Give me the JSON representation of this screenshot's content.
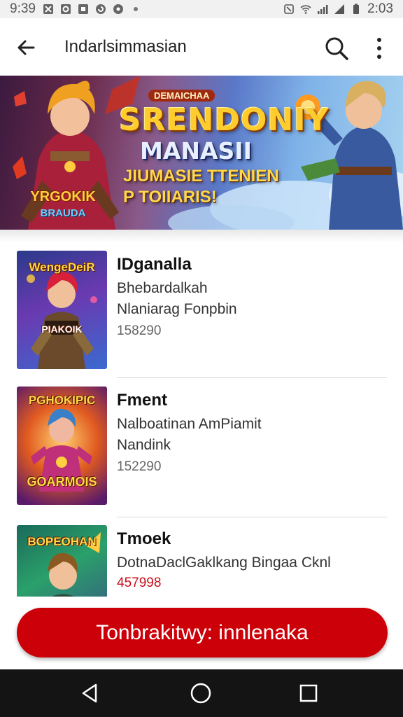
{
  "status_bar": {
    "time_left": "9:39",
    "time_right": "2:03"
  },
  "app_bar": {
    "title": "Indarlsimmasian",
    "back_icon": "arrow-back-icon",
    "search_icon": "search-icon",
    "more_icon": "more-vert-icon"
  },
  "banner": {
    "badge": "DEMAICHAA",
    "title_line1": "SRENDONIY",
    "title_line2": "MANASII",
    "subtitle_line1": "JIUMASIE TTENIEN",
    "subtitle_line2": "P TOIIARIS!",
    "logo_line1": "YRGOKIK",
    "logo_line2": "BRAUDA"
  },
  "list": {
    "items": [
      {
        "title": "IDganalla",
        "line1": "Bhebardalkah",
        "line2": "Nlaniarag Fonpbin",
        "number": "158290",
        "thumb_label_top": "WengeDeiR",
        "thumb_label_bottom": "PIAKOIK"
      },
      {
        "title": "Fment",
        "line1": "Nalboatinan AmPiamit",
        "line2": "Nandink",
        "number": "152290",
        "thumb_label_top": "PGHOKIPIC",
        "thumb_label_bottom": "GOARMOIS"
      },
      {
        "title": "Tmoek",
        "line1": "DotnaDaclGaklkang Bingaa Cknl",
        "line2": "",
        "number": "457998",
        "thumb_label_top": "BOPEOHAN",
        "thumb_label_bottom": ""
      }
    ]
  },
  "cta": {
    "label": "Tonbrakitwy: innlenaka"
  },
  "colors": {
    "accent": "#cc0008",
    "navbar": "#141414",
    "statusbar": "#f1f1f1"
  }
}
